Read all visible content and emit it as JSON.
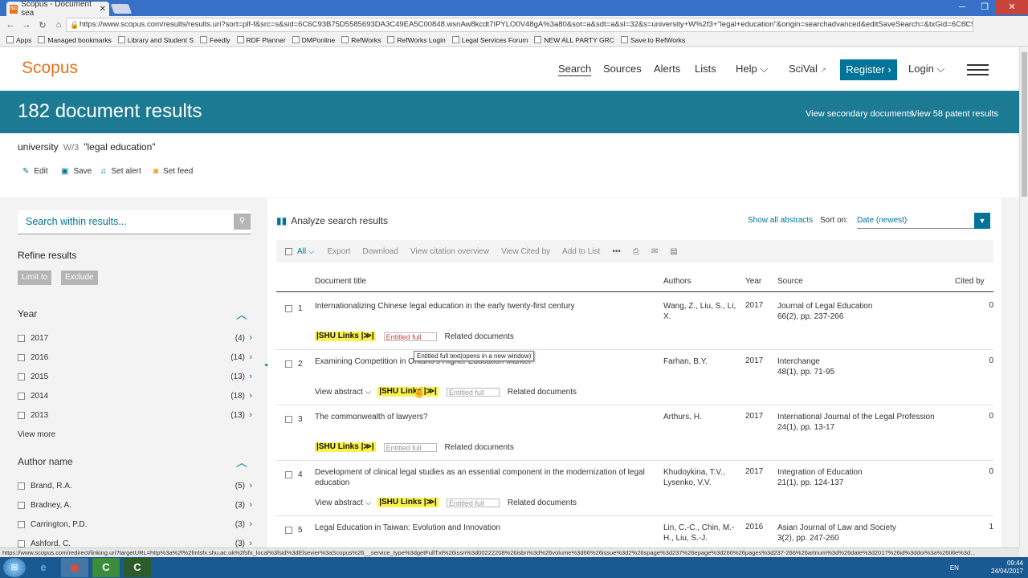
{
  "browser": {
    "tab_title": "Scopus - Document sea",
    "tab_favicon": "SC",
    "url": "https://www.scopus.com/results/results.uri?sort=plf-f&src=s&sid=6C6C93B75D5585693DA3C49EA5C00848.wsnAw8kcdt7IPYLO0V48gA%3a80&sot=a&sdt=a&sl=32&s=university+W%2f3+\"legal+education\"&origin=searchadvanced&editSaveSearch=&txGid=6C6C9:",
    "bookmarks": [
      "Apps",
      "Managed bookmarks",
      "Library and Student S",
      "Feedly",
      "RDF Planner",
      "DMPonline",
      "RefWorks",
      "RefWorks Login",
      "Legal Services Forum",
      "NEW ALL PARTY GRC",
      "Save to RefWorks"
    ]
  },
  "header": {
    "logo": "Scopus",
    "menu": [
      "Search",
      "Sources",
      "Alerts",
      "Lists",
      "Help",
      "SciVal"
    ],
    "register": "Register",
    "login": "Login"
  },
  "banner": {
    "title": "182 document results",
    "secondary": "View secondary documents",
    "patent": "View 58 patent results"
  },
  "query": {
    "term1": "university",
    "operator": "W/3",
    "term2": "\"legal education\"",
    "actions": [
      "Edit",
      "Save",
      "Set alert",
      "Set feed"
    ]
  },
  "filters": {
    "search_placeholder": "Search within results...",
    "refine": "Refine results",
    "limit": "Limit to",
    "exclude": "Exclude",
    "year_label": "Year",
    "years": [
      {
        "label": "2017",
        "count": "(4)"
      },
      {
        "label": "2016",
        "count": "(14)"
      },
      {
        "label": "2015",
        "count": "(13)"
      },
      {
        "label": "2014",
        "count": "(18)"
      },
      {
        "label": "2013",
        "count": "(13)"
      }
    ],
    "view_more": "View more",
    "author_label": "Author name",
    "authors": [
      {
        "label": "Brand, R.A.",
        "count": "(5)"
      },
      {
        "label": "Bradney, A.",
        "count": "(3)"
      },
      {
        "label": "Carrington, P.D.",
        "count": "(3)"
      },
      {
        "label": "Ashford, C.",
        "count": "(3)"
      }
    ]
  },
  "results": {
    "analyze": "Analyze search results",
    "show_abstracts": "Show all abstracts",
    "sort_label": "Sort on:",
    "sort_value": "Date (newest)",
    "toolbar": {
      "all": "All",
      "items": [
        "Export",
        "Download",
        "View citation overview",
        "View Cited by",
        "Add to List"
      ]
    },
    "columns": {
      "title": "Document title",
      "authors": "Authors",
      "year": "Year",
      "source": "Source",
      "cited": "Cited by"
    },
    "view_abstract": "View abstract",
    "shu_links": "|SHU Links |≫|",
    "entitled": "Entitled full",
    "related": "Related documents",
    "tooltip": "Entitled full text(opens in a new window)",
    "rows": [
      {
        "num": "1",
        "title": "Internationalizing Chinese legal education in the early twenty-first century",
        "authors": "Wang, Z., Liu, S., Li, X.",
        "year": "2017",
        "source": "Journal of Legal Education",
        "source_detail": "66(2), pp. 237-266",
        "cited": "0"
      },
      {
        "num": "2",
        "title": "Examining Competition in Ontario's Higher Education Market",
        "authors": "Farhan, B.Y.",
        "year": "2017",
        "source": "Interchange",
        "source_detail": "48(1), pp. 71-95",
        "cited": "0"
      },
      {
        "num": "3",
        "title": "The commonwealth of lawyers?",
        "authors": "Arthurs, H.",
        "year": "2017",
        "source": "International Journal of the Legal Profession",
        "source_detail": "24(1), pp. 13-17",
        "cited": "0"
      },
      {
        "num": "4",
        "title": "Development of clinical legal studies as an essential component in the modernization of legal education",
        "authors": "Khudoykina, T.V., Lysenko, V.V.",
        "year": "2017",
        "source": "Integration of Education",
        "source_detail": "21(1), pp. 124-137",
        "cited": "0"
      },
      {
        "num": "5",
        "title": "Legal Education in Taiwan: Evolution and Innovation",
        "authors": "Lin, C.-C., Chin, M.-H., Liu, S.-J.",
        "year": "2016",
        "source": "Asian Journal of Law and Society",
        "source_detail": "3(2), pp. 247-260",
        "cited": "1"
      }
    ]
  },
  "status_url": "https://www.scopus.com/redirect/linking.uri?targetURL=http%3a%2f%2fmlsfx.shu.ac.uk%2fsfx_local%3fsid%3dElsevier%3aScopus%26__service_type%3dgetFullTxt%26issn%3d00222208%26isbn%3d%26volume%3d66%26issue%3d2%26spage%3d237%26epage%3d266%26pages%3d237-266%26artnum%3d%26date%3d2017%26id%3ddoi%3a%26title%3d...",
  "taskbar": {
    "lang": "EN",
    "time": "09:44",
    "date": "24/04/2017"
  }
}
